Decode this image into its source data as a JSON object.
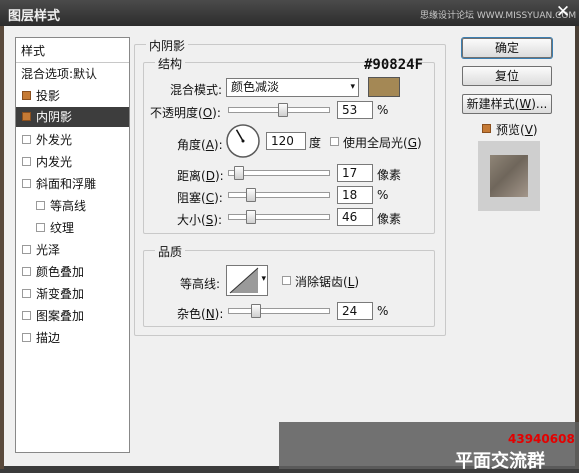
{
  "window": {
    "title": "图层样式",
    "watermark": "思缘设计论坛 WWW.MISSYUAN.COM",
    "close": "✕"
  },
  "sidebar": {
    "items": [
      {
        "label": "样式",
        "checkbox": "none",
        "indent": 0
      },
      {
        "label": "混合选项:默认",
        "checkbox": "none",
        "indent": 0
      },
      {
        "label": "投影",
        "checkbox": "checked",
        "indent": 0
      },
      {
        "label": "内阴影",
        "checkbox": "checked",
        "indent": 0,
        "selected": true
      },
      {
        "label": "外发光",
        "checkbox": "unchecked",
        "indent": 0
      },
      {
        "label": "内发光",
        "checkbox": "unchecked",
        "indent": 0
      },
      {
        "label": "斜面和浮雕",
        "checkbox": "unchecked",
        "indent": 0
      },
      {
        "label": "等高线",
        "checkbox": "unchecked",
        "indent": 1
      },
      {
        "label": "纹理",
        "checkbox": "unchecked",
        "indent": 1
      },
      {
        "label": "光泽",
        "checkbox": "unchecked",
        "indent": 0
      },
      {
        "label": "颜色叠加",
        "checkbox": "unchecked",
        "indent": 0
      },
      {
        "label": "渐变叠加",
        "checkbox": "unchecked",
        "indent": 0
      },
      {
        "label": "图案叠加",
        "checkbox": "unchecked",
        "indent": 0
      },
      {
        "label": "描边",
        "checkbox": "unchecked",
        "indent": 0
      }
    ]
  },
  "panel": {
    "title": "内阴影",
    "structure": {
      "title": "结构",
      "blend_mode": {
        "label": "混合模式:",
        "value": "颜色减淡"
      },
      "color_hex": "#90824F",
      "color_swatch": "#a48855",
      "opacity": {
        "label_pre": "不透明度(",
        "key": "O",
        "label_post": "):",
        "value": "53",
        "unit": "%",
        "level": 53
      },
      "angle": {
        "label_pre": "角度(",
        "key": "A",
        "label_post": "):",
        "value": "120",
        "unit": "度",
        "degrees": 120
      },
      "global_light": {
        "label_pre": "使用全局光(",
        "key": "G",
        "label_post": ")",
        "checked": false
      },
      "distance": {
        "label_pre": "距离(",
        "key": "D",
        "label_post": "):",
        "value": "17",
        "unit": "像素",
        "level": 5
      },
      "choke": {
        "label_pre": "阻塞(",
        "key": "C",
        "label_post": "):",
        "value": "18",
        "unit": "%",
        "level": 18
      },
      "size": {
        "label_pre": "大小(",
        "key": "S",
        "label_post": "):",
        "value": "46",
        "unit": "像素",
        "level": 18
      }
    },
    "quality": {
      "title": "品质",
      "contour_label": "等高线:",
      "antialias": {
        "label_pre": "消除锯齿(",
        "key": "L",
        "label_post": ")",
        "checked": false
      },
      "noise": {
        "label_pre": "杂色(",
        "key": "N",
        "label_post": "):",
        "value": "24",
        "unit": "%",
        "level": 24
      }
    }
  },
  "buttons": {
    "ok": {
      "pre": "确定",
      "key": "",
      "post": ""
    },
    "reset": {
      "pre": "复位",
      "key": "",
      "post": ""
    },
    "new_style": {
      "pre": "新建样式(",
      "key": "W",
      "post": ")..."
    },
    "preview": {
      "pre": "预览(",
      "key": "V",
      "post": ")",
      "checked": true
    }
  },
  "overlay": {
    "number": "43940608",
    "group": "平面交流群"
  }
}
